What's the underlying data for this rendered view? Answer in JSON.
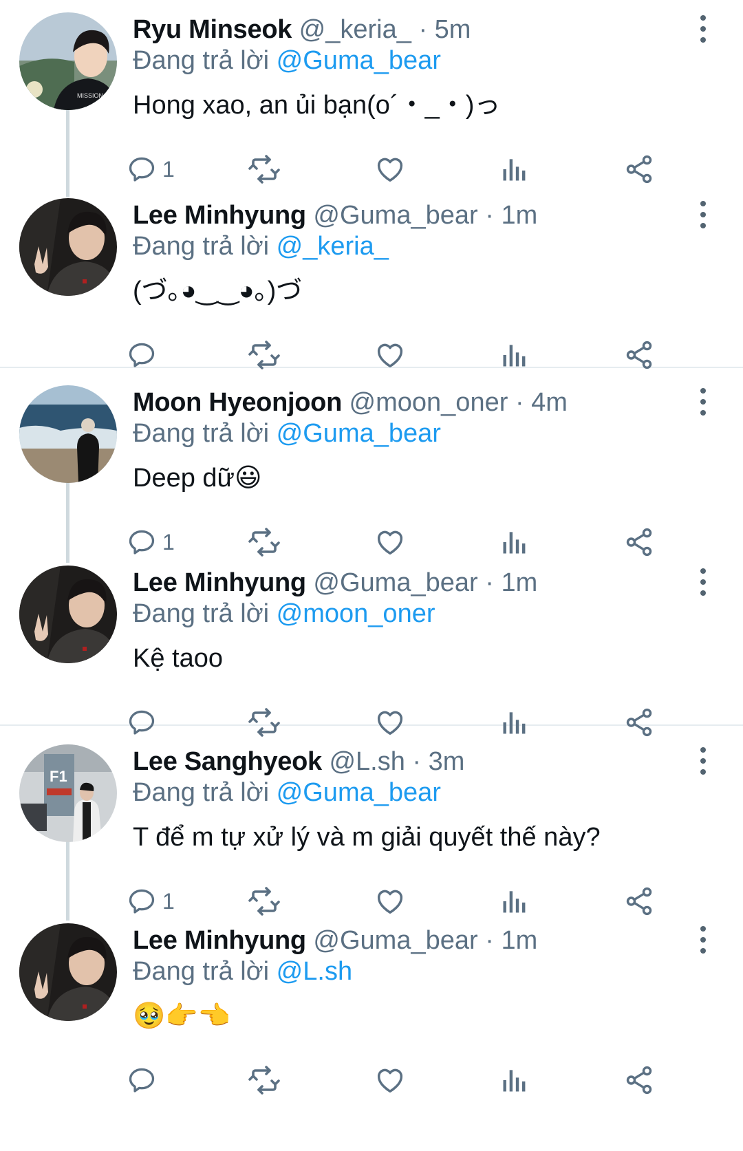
{
  "colors": {
    "mention": "#1d9bf0",
    "muted": "#5b7083",
    "icon": "#5b7083",
    "thread": "#cfd9de"
  },
  "tweets": [
    {
      "name": "Ryu Minseok",
      "handle": "@_keria_",
      "dot": "·",
      "time": "5m",
      "reply_label": "Đang trả lời",
      "reply_to": "@Guma_bear",
      "text": "Hong xao, an ủi bạn(o´・_・)っ",
      "reply_count": "1",
      "avatar": "avatar-ryu"
    },
    {
      "name": "Lee Minhyung",
      "handle": "@Guma_bear",
      "dot": "·",
      "time": "1m",
      "reply_label": "Đang trả lời",
      "reply_to": "@_keria_",
      "text": "(づ｡◕‿‿◕｡)づ",
      "reply_count": "",
      "avatar": "avatar-lee-minhyung"
    },
    {
      "name": "Moon Hyeonjoon",
      "handle": "@moon_oner",
      "dot": "·",
      "time": "4m",
      "reply_label": "Đang trả lời",
      "reply_to": "@Guma_bear",
      "text": "Deep dữ😃",
      "reply_count": "1",
      "avatar": "avatar-moon"
    },
    {
      "name": "Lee Minhyung",
      "handle": "@Guma_bear",
      "dot": "·",
      "time": "1m",
      "reply_label": "Đang trả lời",
      "reply_to": "@moon_oner",
      "text": "Kệ taoo",
      "reply_count": "",
      "avatar": "avatar-lee-minhyung"
    },
    {
      "name": "Lee Sanghyeok",
      "handle": "@L.sh",
      "dot": "·",
      "time": "3m",
      "reply_label": "Đang trả lời",
      "reply_to": "@Guma_bear",
      "text": "T để m tự xử lý và m giải quyết thế này?",
      "reply_count": "1",
      "avatar": "avatar-lee-sanghyeok"
    },
    {
      "name": "Lee Minhyung",
      "handle": "@Guma_bear",
      "dot": "·",
      "time": "1m",
      "reply_label": "Đang trả lời",
      "reply_to": "@L.sh",
      "text": "🥹👉👈",
      "reply_count": "",
      "avatar": "avatar-lee-minhyung"
    }
  ],
  "icons": [
    "reply-icon",
    "retweet-icon",
    "like-icon",
    "analytics-icon",
    "share-icon",
    "more-options-icon"
  ]
}
